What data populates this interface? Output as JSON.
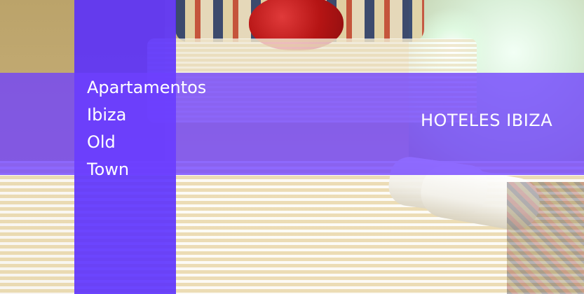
{
  "overlay": {
    "left_title_lines": [
      "Apartamentos",
      "Ibiza",
      "Old",
      "Town"
    ],
    "right_title": "HOTELES IBIZA"
  },
  "colors": {
    "overlay_column": "#582cff",
    "overlay_band": "#6e40ff",
    "text": "#ffffff"
  }
}
